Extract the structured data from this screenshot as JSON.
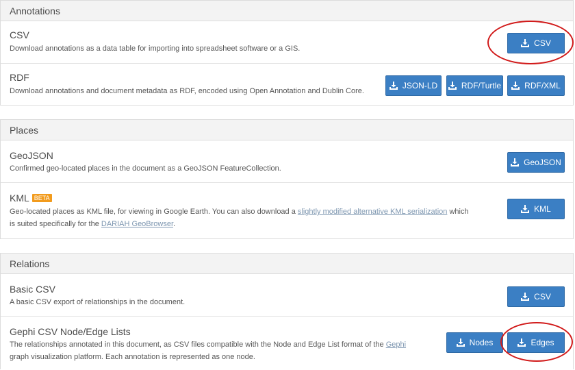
{
  "annotations": {
    "header": "Annotations",
    "csv": {
      "title": "CSV",
      "desc": "Download annotations as a data table for importing into spreadsheet software or a GIS.",
      "button": "CSV"
    },
    "rdf": {
      "title": "RDF",
      "desc": "Download annotations and document metadata as RDF, encoded using Open Annotation and Dublin Core.",
      "buttons": [
        "JSON-LD",
        "RDF/Turtle",
        "RDF/XML"
      ]
    }
  },
  "places": {
    "header": "Places",
    "geojson": {
      "title": "GeoJSON",
      "desc": "Confirmed geo-located places in the document as a GeoJSON FeatureCollection.",
      "button": "GeoJSON"
    },
    "kml": {
      "title": "KML",
      "badge": "BETA",
      "desc_prefix": "Geo-located places as KML file, for viewing in Google Earth. You can also download a ",
      "desc_link1": "slightly modified alternative KML serialization",
      "desc_mid": " which is suited specifically for the ",
      "desc_link2": "DARIAH GeoBrowser",
      "desc_suffix": ".",
      "button": "KML"
    }
  },
  "relations": {
    "header": "Relations",
    "basic_csv": {
      "title": "Basic CSV",
      "desc": "A basic CSV export of relationships in the document.",
      "button": "CSV"
    },
    "gephi": {
      "title": "Gephi CSV Node/Edge Lists",
      "desc_prefix": "The relationships annotated in this document, as CSV files compatible with the Node and Edge List format of the ",
      "desc_link": "Gephi",
      "desc_suffix": " graph visualization platform. Each annotation is represented as one node.",
      "buttons": [
        "Nodes",
        "Edges"
      ]
    }
  },
  "colors": {
    "button": "#3b7fc4",
    "badge": "#f29b1d",
    "highlight": "#d11a1a"
  },
  "icons": {
    "download": "download-icon"
  }
}
